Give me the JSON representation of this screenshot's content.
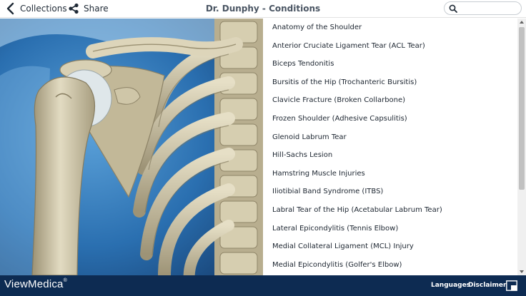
{
  "header": {
    "back_label": "Collections",
    "share_label": "Share",
    "title": "Dr. Dunphy - Conditions",
    "search_placeholder": ""
  },
  "conditions": [
    "Anatomy of the Shoulder",
    "Anterior Cruciate Ligament Tear (ACL Tear)",
    "Biceps Tendonitis",
    "Bursitis of the Hip (Trochanteric Bursitis)",
    "Clavicle Fracture (Broken Collarbone)",
    "Frozen Shoulder (Adhesive Capsulitis)",
    "Glenoid Labrum Tear",
    "Hill-Sachs Lesion",
    "Hamstring Muscle Injuries",
    "Iliotibial Band Syndrome (ITBS)",
    "Labral Tear of the Hip (Acetabular Labrum Tear)",
    "Lateral Epicondylitis (Tennis Elbow)",
    "Medial Collateral Ligament (MCL) Injury",
    "Medial Epicondylitis (Golfer's Elbow)"
  ],
  "footer": {
    "brand": "ViewMedica",
    "brand_mark": "®",
    "languages_label": "Languages",
    "disclaimer_label": "Disclaimer"
  },
  "colors": {
    "footer_bg": "#0d2b52",
    "hero_bg": "#2a6fb0",
    "bone": "#d8d0b4"
  },
  "icons": {
    "back": "chevron-left-icon",
    "share": "share-icon",
    "search": "search-icon",
    "fullscreen": "fullscreen-icon"
  }
}
